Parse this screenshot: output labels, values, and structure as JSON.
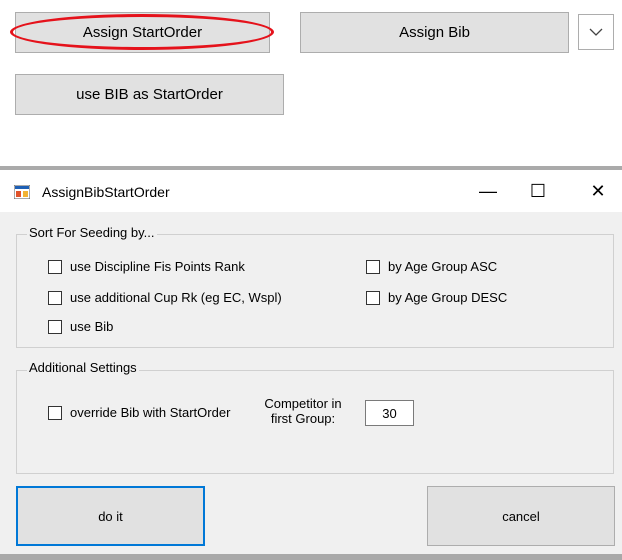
{
  "toolbar": {
    "assign_startorder_label": "Assign StartOrder",
    "assign_bib_label": "Assign Bib",
    "use_bib_as_startorder_label": "use BIB as StartOrder",
    "highlight_color": "#e5121b"
  },
  "dialog": {
    "title": "AssignBibStartOrder",
    "controls": {
      "minimize": "—",
      "maximize": "☐",
      "close": "✕"
    },
    "sort_group": {
      "label": "Sort For Seeding by...",
      "options": [
        {
          "label": "use Discipline Fis Points Rank",
          "checked": false
        },
        {
          "label": "use additional Cup Rk (eg EC, Wspl)",
          "checked": false
        },
        {
          "label": "use Bib",
          "checked": false
        },
        {
          "label": "by Age Group ASC",
          "checked": false
        },
        {
          "label": "by Age Group DESC",
          "checked": false
        }
      ]
    },
    "additional_group": {
      "label": "Additional Settings",
      "override_label": "override Bib with StartOrder",
      "override_checked": false,
      "competitor_label_line1": "Competitor in",
      "competitor_label_line2": "first Group:",
      "competitor_value": "30"
    },
    "do_it_label": "do it",
    "cancel_label": "cancel",
    "focus_color": "#0078d7"
  }
}
